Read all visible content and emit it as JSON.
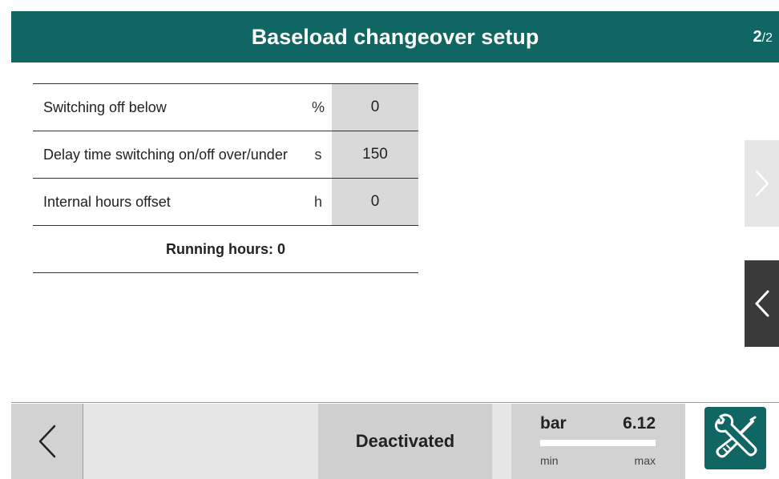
{
  "header": {
    "title": "Baseload changeover setup",
    "page_current": "2",
    "page_total": "/2"
  },
  "parameters": [
    {
      "label": "Switching off below",
      "unit": "%",
      "value": "0"
    },
    {
      "label": "Delay time switching on/off over/under",
      "unit": "s",
      "value": "150"
    },
    {
      "label": "Internal hours offset",
      "unit": "h",
      "value": "0"
    }
  ],
  "running_hours": "Running hours: 0",
  "nav": {
    "next_icon": "chevron-right-icon",
    "prev_icon": "chevron-left-icon"
  },
  "footer": {
    "back_icon": "chevron-left-icon",
    "status": "Deactivated",
    "gauge": {
      "unit": "bar",
      "value": "6.12",
      "min_label": "min",
      "max_label": "max",
      "fill_fraction": 1.0
    },
    "tools_icon": "wrench-screwdriver-icon"
  },
  "colors": {
    "header_bg": "#0f6662",
    "value_cell_bg": "#d9d9d9",
    "tools_bg": "#0f6662",
    "nav_prev_bg": "#3a3a3a"
  }
}
